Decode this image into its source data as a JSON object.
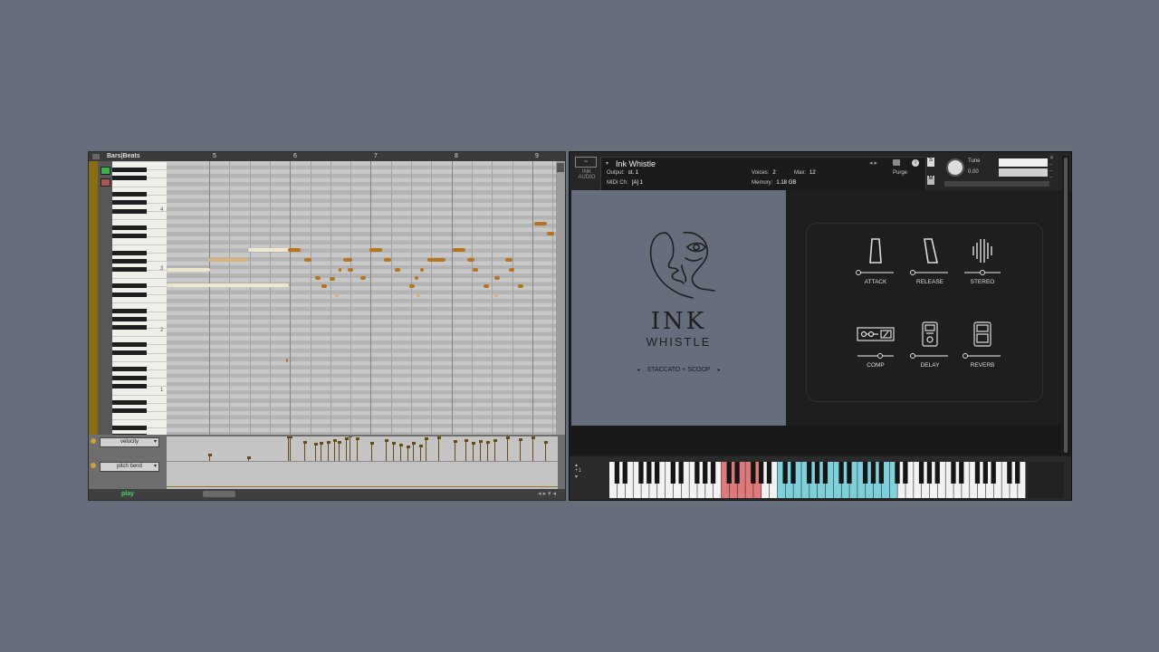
{
  "editor": {
    "ruler_label": "Bars|Beats",
    "bars": [
      "5",
      "6",
      "7",
      "8",
      "9"
    ],
    "octaves": [
      "4",
      "3",
      "2",
      "1"
    ],
    "lanes": [
      {
        "label": "velocity"
      },
      {
        "label": "pitch bend"
      }
    ],
    "status_text": "play",
    "nav_arrows": "◂ ▸ ▾ ◂"
  },
  "plugin": {
    "logo": "~",
    "brand": "INK AUDIO",
    "instrument_name": "Ink Whistle",
    "output_label": "Output:",
    "output_value": "st. 1",
    "voices_label": "Voices:",
    "voices_value": "2",
    "max_label": "Max:",
    "max_value": "12",
    "midi_label": "MIDI Ch:",
    "midi_value": "[A]  1",
    "memory_label": "Memory:",
    "memory_value": "1.18 GB",
    "purge_label": "Purge",
    "info_glyph": "i",
    "solo_glyph": "S",
    "mute_glyph": "M",
    "tune_label": "Tune",
    "tune_value": "0.00",
    "title_line1": "INK",
    "title_line2": "WHISTLE",
    "articulation": "STACCATO + SCOOP",
    "art_prev": "◂",
    "art_next": "▸",
    "controls": [
      {
        "label": "ATTACK",
        "icon": "attack-icon",
        "value": 0.0
      },
      {
        "label": "RELEASE",
        "icon": "release-icon",
        "value": 0.0
      },
      {
        "label": "STEREO",
        "icon": "stereo-icon",
        "value": 0.5
      },
      {
        "label": "COMP",
        "icon": "compressor-icon",
        "value": 0.6
      },
      {
        "label": "DELAY",
        "icon": "delay-pedal-icon",
        "value": 0.0
      },
      {
        "label": "REVERB",
        "icon": "reverb-pedal-icon",
        "value": 0.0
      }
    ],
    "kbd_octave": "+1",
    "accent_red": "#e07a7a",
    "accent_blue": "#7ed0dd"
  }
}
